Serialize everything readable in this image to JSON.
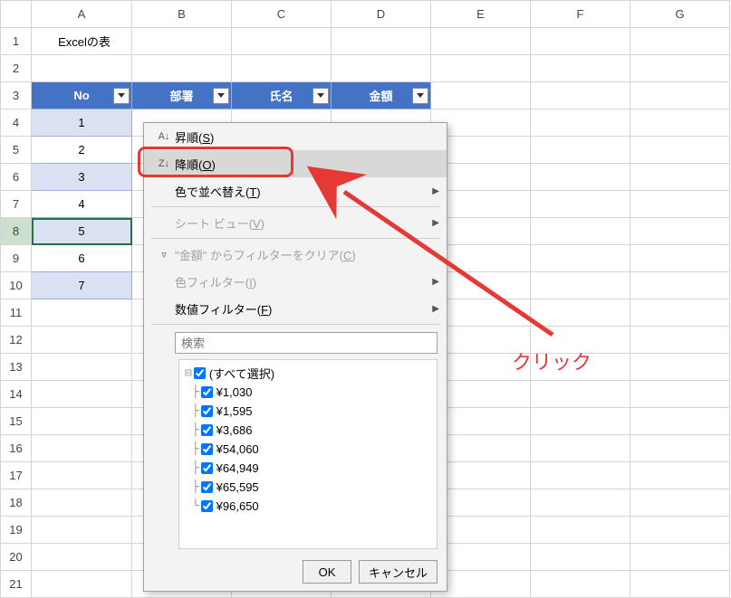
{
  "columns": [
    "A",
    "B",
    "C",
    "D",
    "E",
    "F",
    "G"
  ],
  "rows": [
    "1",
    "2",
    "3",
    "4",
    "5",
    "6",
    "7",
    "8",
    "9",
    "10",
    "11",
    "12",
    "13",
    "14",
    "15",
    "16",
    "17",
    "18",
    "19",
    "20",
    "21"
  ],
  "title": "Excelの表",
  "headers": {
    "no": "No",
    "dept": "部署",
    "name": "氏名",
    "amount": "金額"
  },
  "data_no": [
    "1",
    "2",
    "3",
    "4",
    "5",
    "6",
    "7"
  ],
  "menu": {
    "asc": "昇順(",
    "asc_key": "S",
    "asc_close": ")",
    "desc": "降順(",
    "desc_key": "O",
    "desc_close": ")",
    "sortcolor": "色で並べ替え(",
    "sortcolor_key": "T",
    "sortcolor_close": ")",
    "sheetview": "シート ビュー(",
    "sheetview_key": "V",
    "sheetview_close": ")",
    "clearfilter": "\"金額\" からフィルターをクリア(",
    "clearfilter_key": "C",
    "clearfilter_close": ")",
    "colorfilter": "色フィルター(",
    "colorfilter_key": "I",
    "colorfilter_close": ")",
    "numfilter": "数値フィルター(",
    "numfilter_key": "F",
    "numfilter_close": ")"
  },
  "search_placeholder": "検索",
  "filter_items": [
    "(すべて選択)",
    "¥1,030",
    "¥1,595",
    "¥3,686",
    "¥54,060",
    "¥64,949",
    "¥65,595",
    "¥96,650"
  ],
  "buttons": {
    "ok": "OK",
    "cancel": "キャンセル"
  },
  "annotation": "クリック"
}
